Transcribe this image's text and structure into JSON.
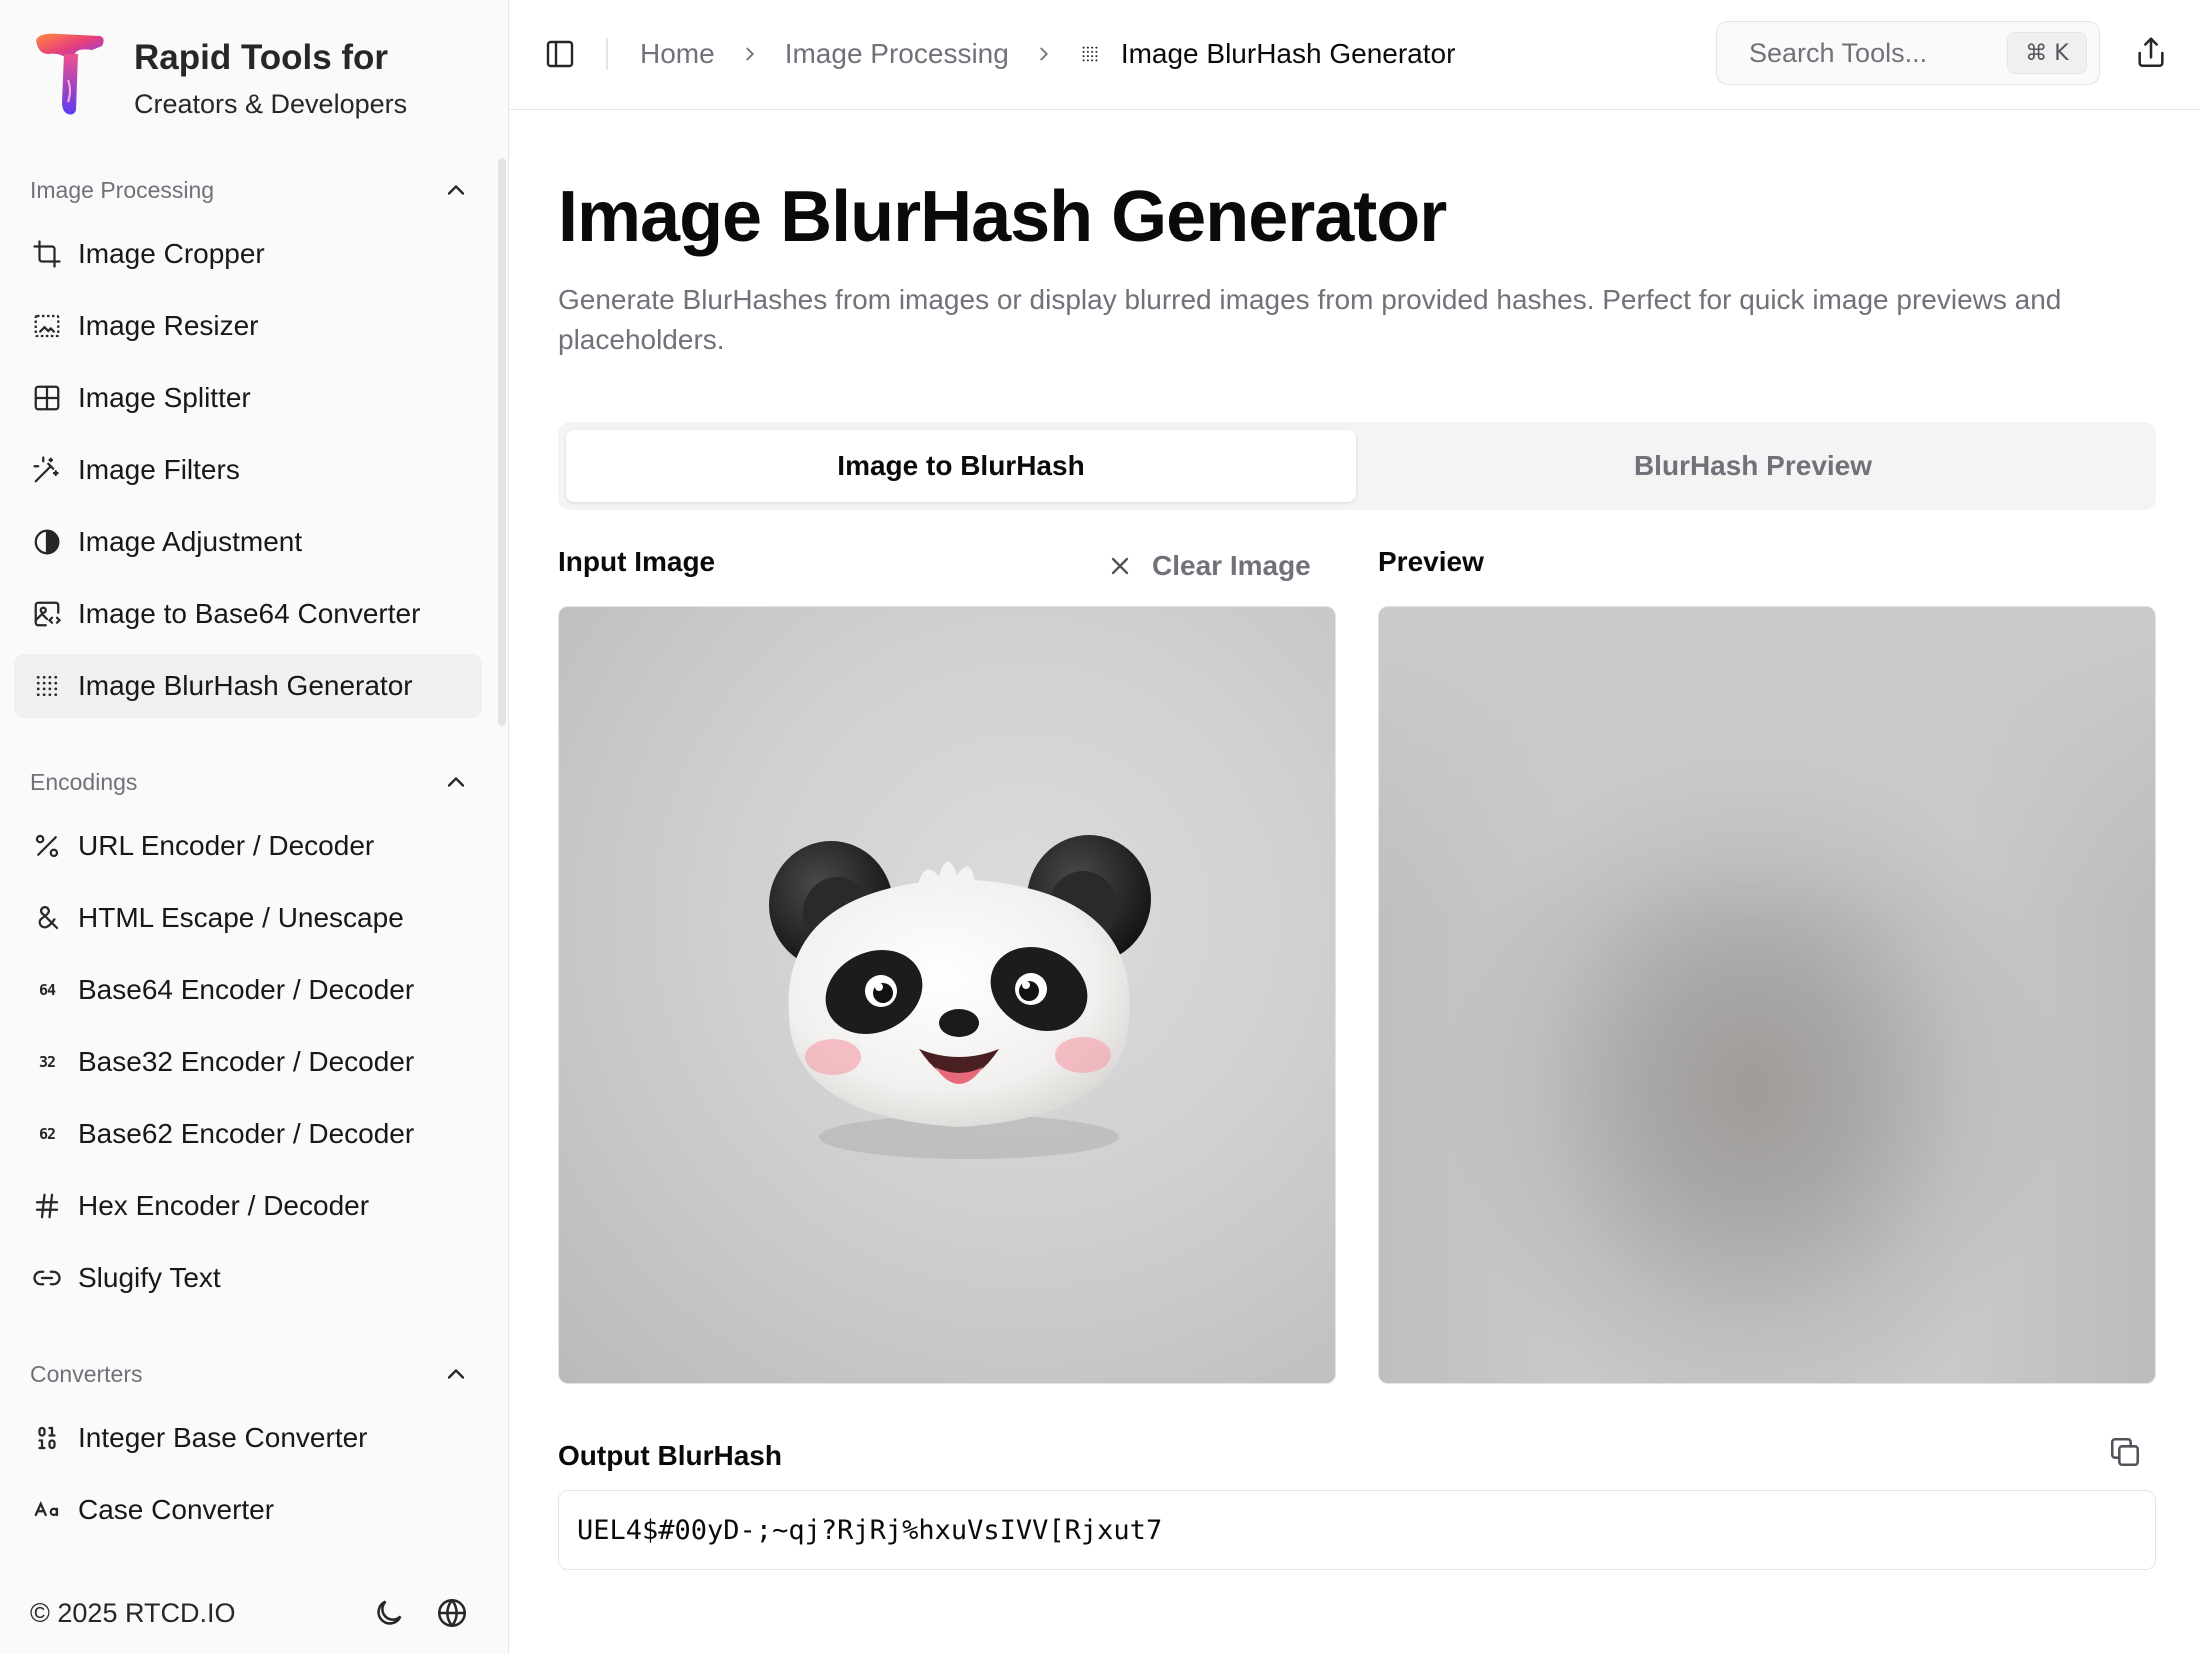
{
  "brand": {
    "title": "Rapid Tools for",
    "subtitle": "Creators & Developers"
  },
  "sidebar": {
    "sections": [
      {
        "label": "Image Processing",
        "items": [
          {
            "label": "Image Cropper",
            "icon": "crop-icon"
          },
          {
            "label": "Image Resizer",
            "icon": "image-resize-icon"
          },
          {
            "label": "Image Splitter",
            "icon": "grid-icon"
          },
          {
            "label": "Image Filters",
            "icon": "magic-wand-icon"
          },
          {
            "label": "Image Adjustment",
            "icon": "contrast-icon"
          },
          {
            "label": "Image to Base64 Converter",
            "icon": "image-code-icon"
          },
          {
            "label": "Image BlurHash Generator",
            "icon": "dots-grid-icon",
            "active": true
          }
        ]
      },
      {
        "label": "Encodings",
        "items": [
          {
            "label": "URL Encoder / Decoder",
            "icon": "percent-icon"
          },
          {
            "label": "HTML Escape / Unescape",
            "icon": "ampersand-icon"
          },
          {
            "label": "Base64 Encoder / Decoder",
            "icon": "base64-icon",
            "glyph": "64"
          },
          {
            "label": "Base32 Encoder / Decoder",
            "icon": "base32-icon",
            "glyph": "32"
          },
          {
            "label": "Base62 Encoder / Decoder",
            "icon": "base62-icon",
            "glyph": "62"
          },
          {
            "label": "Hex Encoder / Decoder",
            "icon": "hash-icon"
          },
          {
            "label": "Slugify Text",
            "icon": "link-icon"
          }
        ]
      },
      {
        "label": "Converters",
        "items": [
          {
            "label": "Integer Base Converter",
            "icon": "binary-icon"
          },
          {
            "label": "Case Converter",
            "icon": "case-icon"
          }
        ]
      }
    ],
    "footer": {
      "copyright": "© 2025 RTCD.IO"
    }
  },
  "topbar": {
    "breadcrumb": [
      "Home",
      "Image Processing",
      "Image BlurHash Generator"
    ],
    "search_placeholder": "Search Tools...",
    "shortcut": "⌘ K"
  },
  "main": {
    "title": "Image BlurHash Generator",
    "description": "Generate BlurHashes from images or display blurred images from provided hashes. Perfect for quick image previews and placeholders.",
    "tabs": [
      {
        "label": "Image to BlurHash",
        "active": true
      },
      {
        "label": "BlurHash Preview",
        "active": false
      }
    ],
    "input_label": "Input Image",
    "clear_label": "Clear Image",
    "preview_label": "Preview",
    "output_label": "Output BlurHash",
    "output_value": "UEL4$#00yD-;~qj?RjRj%hxuVsIVV[Rjxut7"
  }
}
